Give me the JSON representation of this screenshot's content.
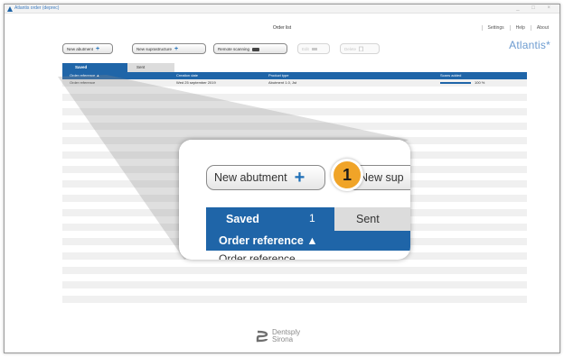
{
  "window": {
    "title": "Atlantis order (deprec)",
    "screen_title": "Order list",
    "controls": "_ □ ×"
  },
  "menu": [
    "Settings",
    "Help",
    "About"
  ],
  "brand": "Atlantis*",
  "toolbar": {
    "new_abutment": "New abutment",
    "new_suprastructure": "New suprastructure",
    "remote_scanning": "Remote scanning",
    "disabled_1": "Edit",
    "disabled_2": "Delete"
  },
  "tabs": {
    "saved": "Saved",
    "sent": "Sent",
    "saved_count": "1"
  },
  "table": {
    "columns": [
      "Order reference ▲",
      "Creation date",
      "Product type",
      "Scans added"
    ],
    "rows": [
      {
        "order_reference": "Order reference",
        "creation_date": "Wed 25 september 2019",
        "product_type": "Abutment 1.0, Jst",
        "scans_added_percent": 100,
        "scans_added_label": "100 %"
      }
    ]
  },
  "callout": {
    "button_label": "New abutment",
    "button2_label": "New sup",
    "step_number": "1",
    "tab_saved": "Saved",
    "tab_count": "1",
    "tab_sent": "Sent",
    "header": "Order reference ▲",
    "row_text": "Order reference"
  },
  "footer": {
    "line1": "Dentsply",
    "line2": "Sirona"
  },
  "colors": {
    "accent_blue": "#1f65a8",
    "badge_orange": "#f0a428",
    "brand_blue": "#6c9bd0"
  }
}
